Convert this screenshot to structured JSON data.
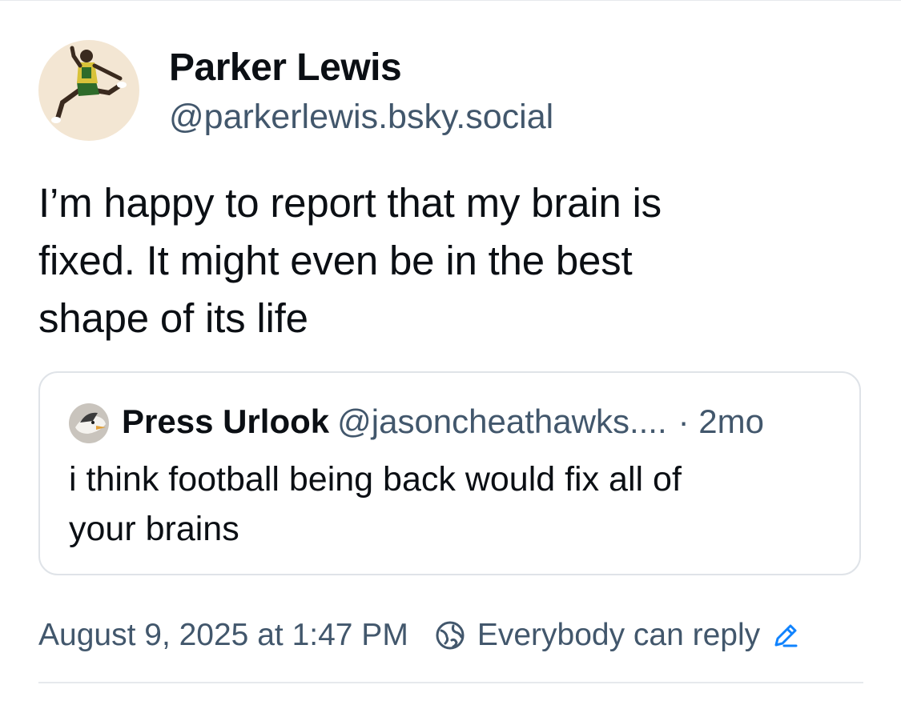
{
  "post": {
    "author": {
      "name": "Parker Lewis",
      "handle": "@parkerlewis.bsky.social",
      "avatar_icon": "jumping-athlete-avatar"
    },
    "text_lines": [
      "I’m happy to report that my brain is",
      "fixed. It might even be in the best",
      "shape of its life"
    ],
    "quoted_post": {
      "author_name": "Press Urlook",
      "author_handle": "@jasoncheathawks....",
      "time": "· 2mo",
      "avatar_icon": "bird-avatar",
      "text_lines": [
        "i think football being back would fix all of",
        "your brains"
      ]
    },
    "meta": {
      "timestamp": "August 9, 2025 at 1:47 PM",
      "reply_setting": "Everybody can reply",
      "reply_icon": "globe-icon",
      "edit_icon": "pencil-icon"
    }
  },
  "colors": {
    "text_primary": "#0b0f14",
    "text_secondary": "#42576c",
    "accent": "#1083fe",
    "border": "#dfe3e8"
  }
}
